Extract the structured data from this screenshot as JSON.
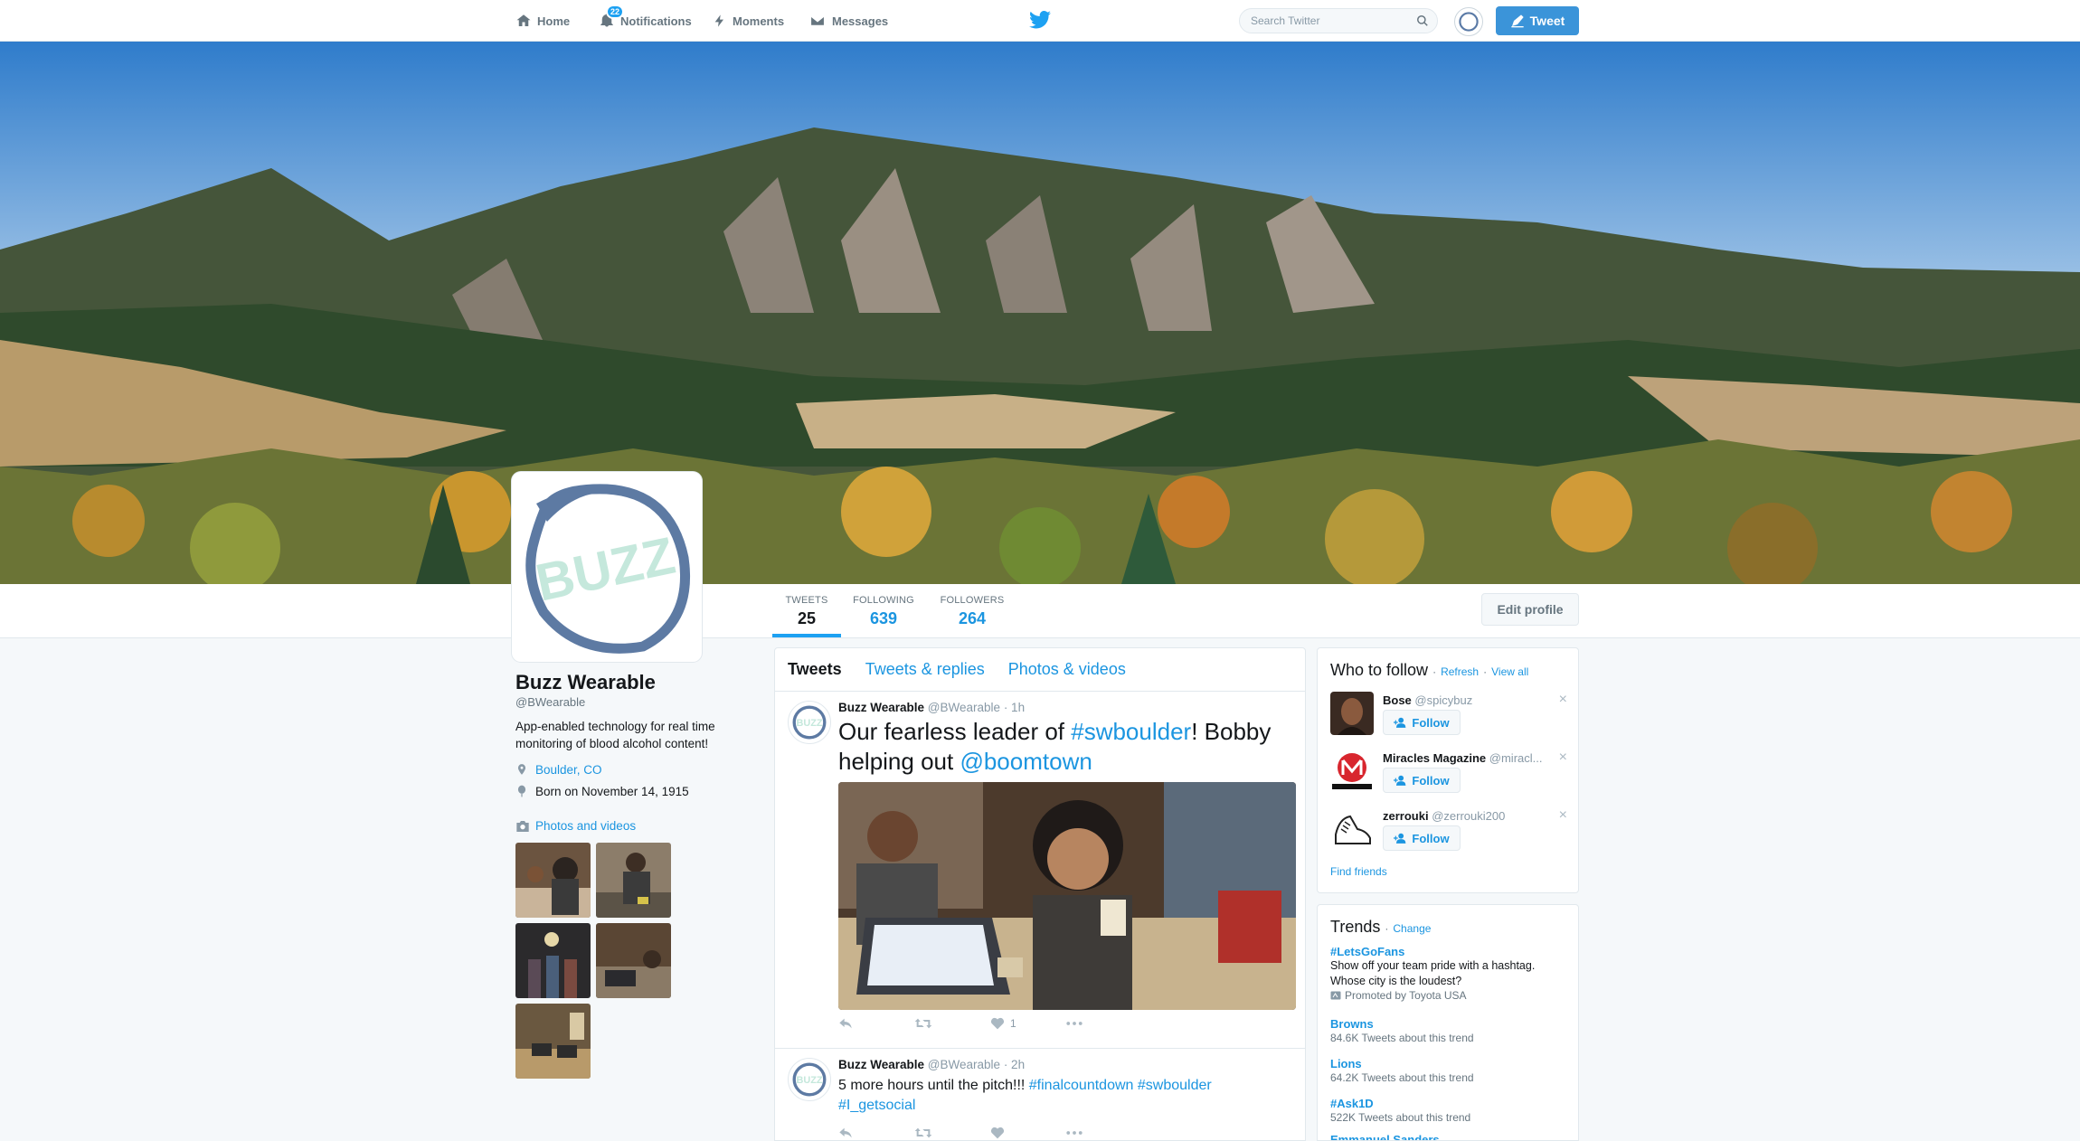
{
  "nav": {
    "home": "Home",
    "notifications": "Notifications",
    "notifications_count": "22",
    "moments": "Moments",
    "messages": "Messages",
    "search_placeholder": "Search Twitter",
    "tweet_button": "Tweet"
  },
  "profile": {
    "name": "Buzz Wearable",
    "handle": "@BWearable",
    "bio": "App-enabled technology for real time monitoring of blood alcohol content!",
    "location": "Boulder, CO",
    "birthday": "Born on November 14, 1915",
    "photos_link": "Photos and videos",
    "avatar_text": "BUZZ",
    "edit_button": "Edit profile"
  },
  "stats": [
    {
      "label": "TWEETS",
      "value": "25"
    },
    {
      "label": "FOLLOWING",
      "value": "639"
    },
    {
      "label": "FOLLOWERS",
      "value": "264"
    }
  ],
  "timeline": {
    "tabs": [
      "Tweets",
      "Tweets & replies",
      "Photos & videos"
    ],
    "tweets": [
      {
        "name": "Buzz Wearable",
        "handle": "@BWearable",
        "time": "· 1h",
        "text_parts": [
          "Our fearless leader of ",
          "#swboulder",
          "! Bobby helping out ",
          "@boomtown"
        ],
        "like_count": "1"
      },
      {
        "name": "Buzz Wearable",
        "handle": "@BWearable",
        "time": "· 2h",
        "text_parts": [
          "5 more hours until the pitch!!! ",
          "#finalcountdown",
          " ",
          "#swboulder",
          " ",
          "#I_getsocial"
        ]
      }
    ]
  },
  "who_to_follow": {
    "title": "Who to follow",
    "refresh": "Refresh",
    "view_all": "View all",
    "dot": "·",
    "follow_label": "Follow",
    "find_friends": "Find friends",
    "users": [
      {
        "name": "Bose",
        "handle": "@spicybuz"
      },
      {
        "name": "Miracles Magazine",
        "handle": "@miracl..."
      },
      {
        "name": "zerrouki",
        "handle": "@zerrouki200"
      }
    ]
  },
  "trends": {
    "title": "Trends",
    "change": "Change",
    "dot": "·",
    "items": [
      {
        "name": "#LetsGoFans",
        "desc": "Show off your team pride with a hashtag. Whose city is the loudest?",
        "meta": "Promoted by Toyota USA"
      },
      {
        "name": "Browns",
        "meta": "84.6K Tweets about this trend"
      },
      {
        "name": "Lions",
        "meta": "64.2K Tweets about this trend"
      },
      {
        "name": "#Ask1D",
        "meta": "522K Tweets about this trend"
      },
      {
        "name": "Emmanuel Sanders"
      }
    ]
  },
  "colors": {
    "accent": "#1da1f2",
    "link": "#1b95e0",
    "tweet_button": "#3b94d9",
    "background": "#f5f8fa"
  }
}
